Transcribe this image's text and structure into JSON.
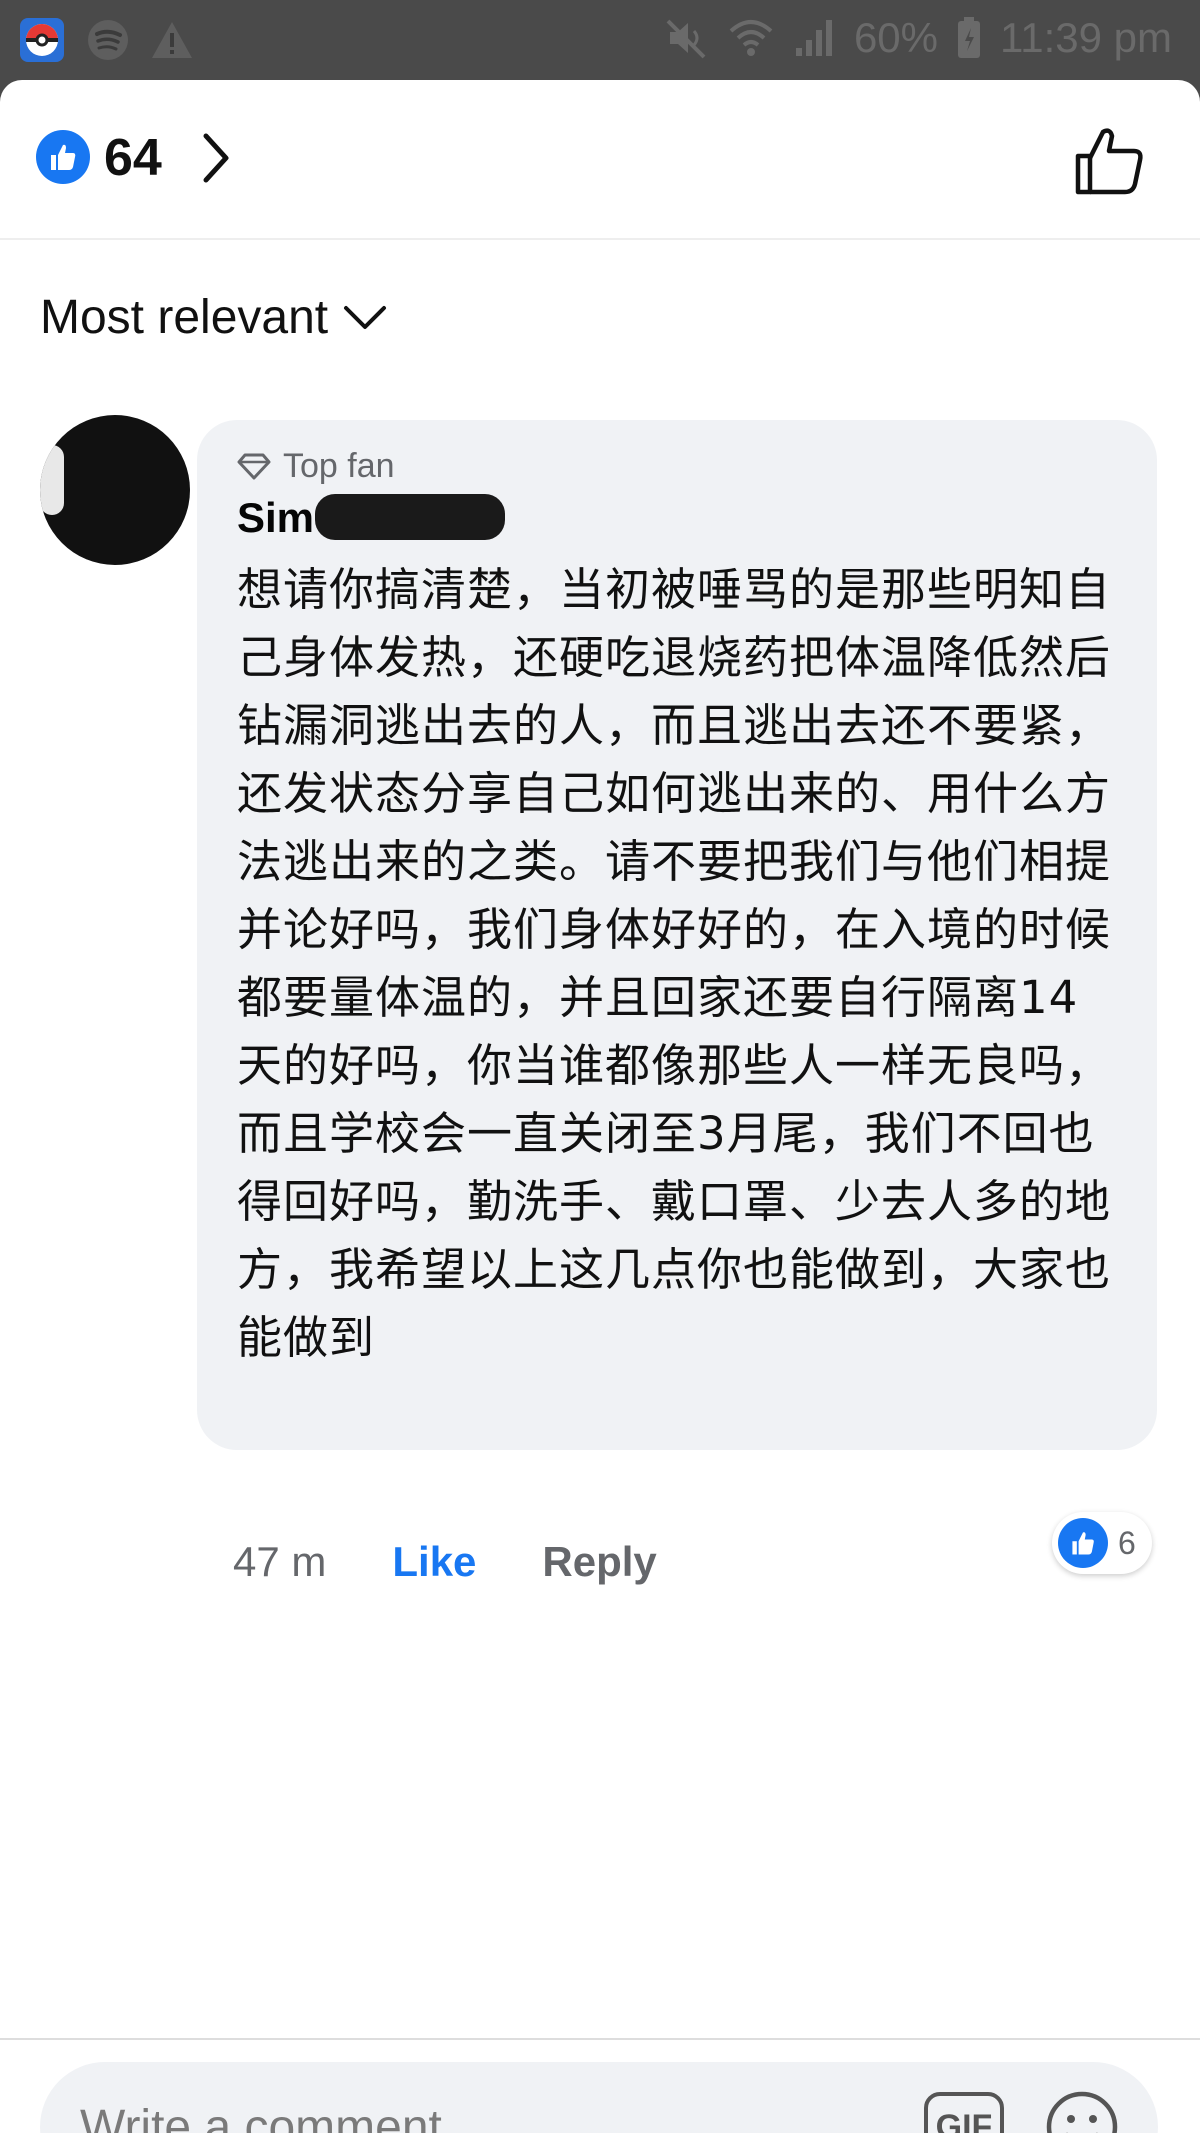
{
  "status_bar": {
    "battery": "60%",
    "time": "11:39 pm"
  },
  "reactions": {
    "count": "64"
  },
  "sort": {
    "label": "Most relevant"
  },
  "comment": {
    "badge": "Top fan",
    "author": "Sim",
    "text": "想请你搞清楚，当初被唾骂的是那些明知自己身体发热，还硬吃退烧药把体温降低然后钻漏洞逃出去的人，而且逃出去还不要紧，还发状态分享自己如何逃出来的、用什么方法逃出来的之类。请不要把我们与他们相提并论好吗，我们身体好好的，在入境的时候都要量体温的，并且回家还要自行隔离14天的好吗，你当谁都像那些人一样无良吗，而且学校会一直关闭至3月尾，我们不回也得回好吗，勤洗手、戴口罩、少去人多的地方，我希望以上这几点你也能做到，大家也能做到",
    "time": "47 m",
    "like_label": "Like",
    "reply_label": "Reply",
    "reaction_count": "6"
  },
  "composer": {
    "placeholder": "Write a comment...",
    "gif_label": "GIF"
  },
  "colors": {
    "accent": "#1877f2",
    "bubble": "#f0f2f5",
    "status_bar": "#4a4a4a"
  }
}
